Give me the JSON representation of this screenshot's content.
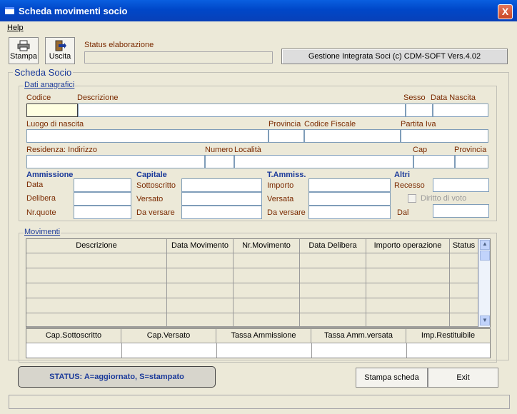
{
  "window": {
    "title": "Scheda movimenti socio",
    "close_label": "X"
  },
  "menu": {
    "help": "Help"
  },
  "toolbar": {
    "print_label": "Stampa",
    "exit_label": "Uscita",
    "status_label": "Status elaborazione",
    "version": "Gestione Integrata Soci (c) CDM-SOFT Vers.4.02"
  },
  "scheda": {
    "title": "Scheda Socio",
    "anagrafica_title": "Dati anagrafici"
  },
  "fields": {
    "codice": "Codice",
    "descrizione": "Descrizione",
    "sesso": "Sesso",
    "data_nascita": "Data Nascita",
    "luogo_nascita": "Luogo di nascita",
    "provincia": "Provincia",
    "codice_fiscale": "Codice Fiscale",
    "partita_iva": "Partita Iva",
    "residenza": "Residenza: Indirizzo",
    "numero": "Numero",
    "localita": "Località",
    "cap": "Cap",
    "provincia2": "Provincia"
  },
  "sections": {
    "ammissione": {
      "title": "Ammissione",
      "data": "Data",
      "delibera": "Delibera",
      "nr_quote": "Nr.quote"
    },
    "capitale": {
      "title": "Capitale",
      "sottoscritto": "Sottoscritto",
      "versato": "Versato",
      "da_versare": "Da versare"
    },
    "t_ammiss": {
      "title": "T.Ammiss.",
      "importo": "Importo",
      "versata": "Versata",
      "da_versare": "Da versare"
    },
    "altri": {
      "title": "Altri",
      "recesso": "Recesso",
      "diritto_voto": "Diritto di voto",
      "dal": "Dal"
    }
  },
  "movimenti": {
    "title": "Movimenti",
    "columns": [
      "Descrizione",
      "Data Movimento",
      "Nr.Movimento",
      "Data Delibera",
      "Importo operazione",
      "Status"
    ],
    "totals_columns": [
      "Cap.Sottoscritto",
      "Cap.Versato",
      "Tassa Ammissione",
      "Tassa Amm.versata",
      "Imp.Restituibile"
    ]
  },
  "footer": {
    "status_text": "STATUS: A=aggiornato, S=stampato",
    "print_card": "Stampa scheda",
    "exit": "Exit"
  }
}
